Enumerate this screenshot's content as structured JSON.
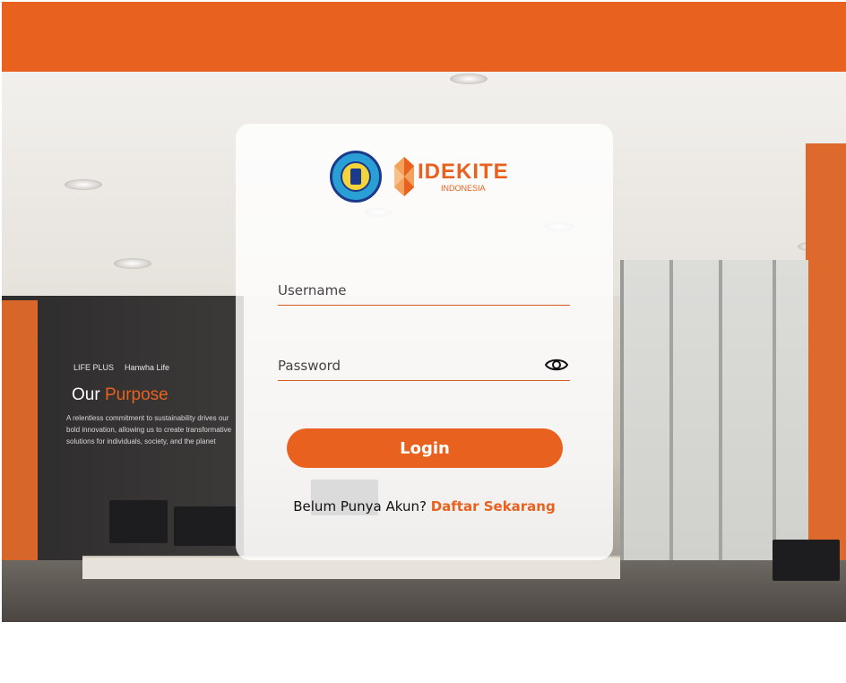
{
  "logos": {
    "institution_seal": "Politeknik Negeri Pontianak seal",
    "brand_name": "IDEKITE",
    "brand_sub": "INDONESIA"
  },
  "background_wall": {
    "logo_left": "LIFE PLUS",
    "logo_right": "Hanwha Life",
    "title_prefix": "Our",
    "title_accent": "Purpose",
    "body": "A relentless commitment to sustainability drives our bold innovation, allowing us to create transformative solutions for individuals, society, and the planet"
  },
  "form": {
    "username_placeholder": "Username",
    "password_placeholder": "Password",
    "password_toggle_icon": "eye-icon",
    "login_label": "Login",
    "signup_prompt": "Belum Punya Akun?",
    "signup_link": "Daftar Sekarang"
  },
  "colors": {
    "accent": "#e8611f",
    "card_bg": "rgba(255,255,255,0.82)"
  }
}
